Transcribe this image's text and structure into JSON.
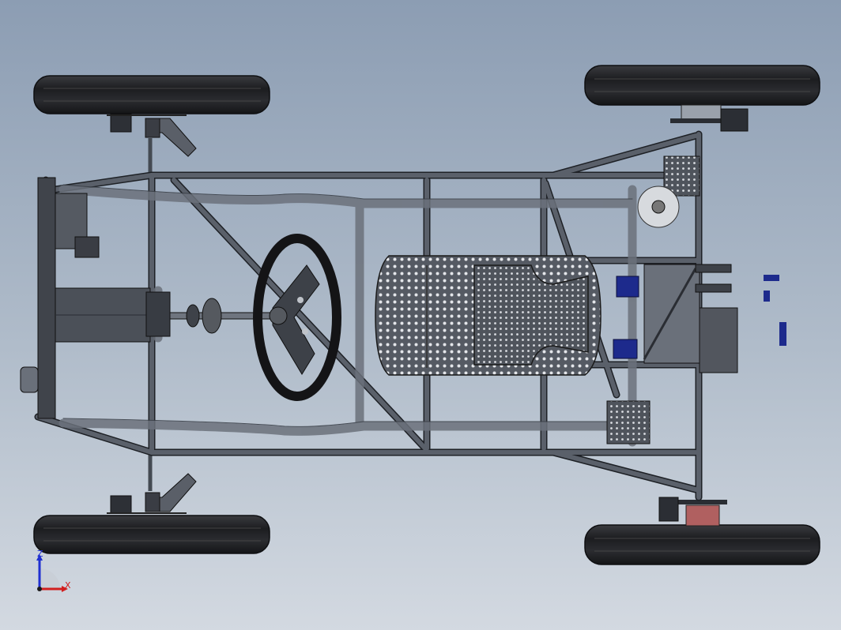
{
  "triad": {
    "z_label": "Z",
    "x_label": "X",
    "colors": {
      "z": "#1f2fd1",
      "x": "#d11f1f",
      "origin": "#1a1a1a"
    }
  },
  "colors": {
    "background_top": "#8c9db3",
    "background_bottom": "#d3d9e1",
    "tube": "#4a4f57",
    "tube_edge": "#1e2126",
    "tire": "#2a2b2e",
    "seat": "#5b5f67",
    "caliper": "#1d2a8c",
    "brake_disc": "#b05050"
  }
}
